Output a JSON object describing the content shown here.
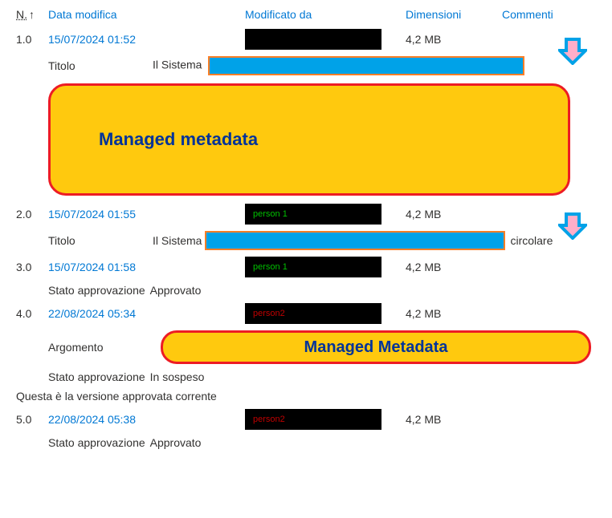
{
  "header": {
    "n": "N.",
    "date": "Data modifica",
    "mod": "Modificato da",
    "size": "Dimensioni",
    "comments": "Commenti"
  },
  "rows": [
    {
      "n": "1.0",
      "date": "15/07/2024 01:52",
      "mod_text": "",
      "mod_class": "",
      "size": "4,2 MB",
      "show_arrow": true,
      "detail_titolo": {
        "label": "Titolo",
        "value": "Il Sistema",
        "bar": true,
        "trailing": ""
      },
      "managed1": "Managed metadata",
      "truncated": true
    },
    {
      "n": "2.0",
      "date": "15/07/2024 01:55",
      "mod_text": "person 1",
      "mod_class": "green-text",
      "size": "4,2 MB",
      "show_arrow": true,
      "detail_titolo": {
        "label": "Titolo",
        "value": "Il Sistema",
        "bar": true,
        "trailing": "circolare"
      }
    },
    {
      "n": "3.0",
      "date": "15/07/2024 01:58",
      "mod_text": "person 1",
      "mod_class": "green-text",
      "size": "4,2 MB",
      "detail_approv": {
        "label": "Stato approvazione",
        "value": "Approvato"
      }
    },
    {
      "n": "4.0",
      "date": "22/08/2024 05:34",
      "mod_text": "person2",
      "mod_class": "red-text",
      "size": "4,2 MB",
      "detail_argomento": {
        "label": "Argomento",
        "managed": "Managed Metadata"
      },
      "detail_approv": {
        "label": "Stato approvazione",
        "value": "In sospeso"
      }
    }
  ],
  "approved_note": "Questa è la versione approvata corrente",
  "row5": {
    "n": "5.0",
    "date": "22/08/2024 05:38",
    "mod_text": "person2",
    "mod_class": "red-text",
    "size": "4,2 MB",
    "detail_approv": {
      "label": "Stato approvazione",
      "value": "Approvato"
    }
  }
}
